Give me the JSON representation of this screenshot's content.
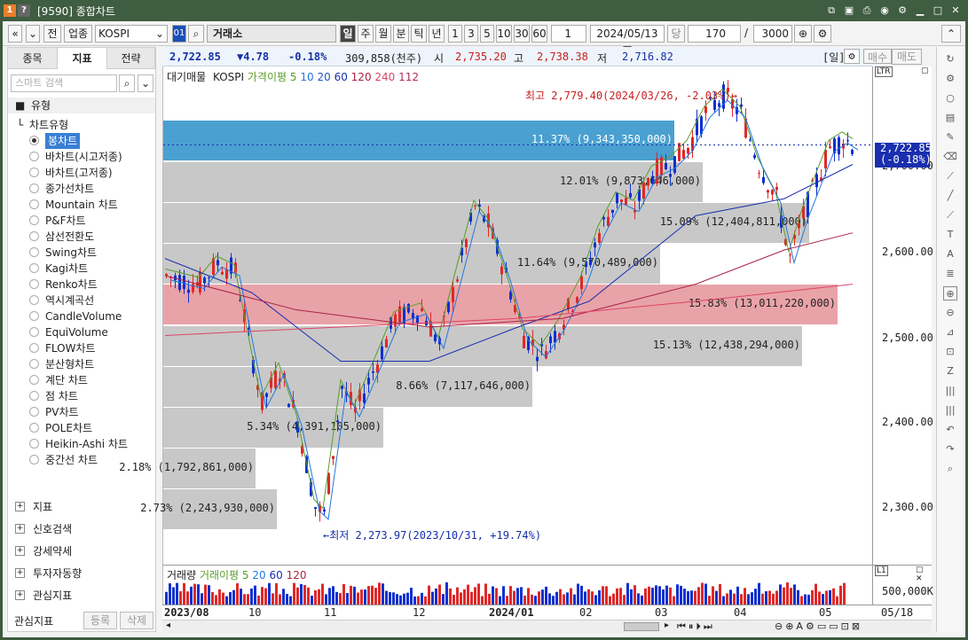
{
  "window": {
    "title": "[9590] 종합차트",
    "badge1": "1",
    "badge2": "?"
  },
  "toolbar": {
    "nav_prev": "«",
    "nav_down": "⌄",
    "jeon": "전",
    "category": "업종",
    "symbol": "KOSPI",
    "market_box": "01",
    "market_name": "거래소",
    "periods": [
      "일",
      "주",
      "월",
      "분",
      "틱",
      "년"
    ],
    "nums": [
      "1",
      "3",
      "5",
      "10",
      "30",
      "60"
    ],
    "period_count": "1",
    "date": "2024/05/13",
    "dang": "당",
    "count": "170",
    "slash": "/",
    "max": "3000"
  },
  "info": {
    "price": "2,722.85",
    "change": "▼4.78",
    "pct": "-0.18%",
    "volume": "309,858(천주)",
    "open_lbl": "시",
    "open": "2,735.20",
    "high_lbl": "고",
    "high": "2,738.38",
    "low_lbl": "저",
    "low": "2,716.82",
    "period": "[일]",
    "buy": "매수",
    "sell": "매도"
  },
  "left": {
    "tabs": [
      "종목",
      "지표",
      "전략"
    ],
    "search_placeholder": "스마트 검색",
    "type_header": "유형",
    "chart_type": "차트유형",
    "items": [
      "봉차트",
      "바차트(시고저종)",
      "바차트(고저종)",
      "종가선차트",
      "Mountain 차트",
      "P&F차트",
      "삼선전환도",
      "Swing차트",
      "Kagi차트",
      "Renko차트",
      "역시계곡선",
      "CandleVolume",
      "EquiVolume",
      "FLOW차트",
      "분산형차트",
      "계단 차트",
      "점 차트",
      "PV차트",
      "POLE차트",
      "Heikin-Ashi 차트",
      "중간선 차트"
    ],
    "sections": [
      "지표",
      "신호검색",
      "강세약세",
      "투자자동향",
      "관심지표"
    ],
    "bottom_label": "관심지표",
    "btn_reg": "등록",
    "btn_del": "삭제"
  },
  "legend": {
    "main": "대기매물",
    "sym": "KOSPI",
    "ma": "가격이평 5",
    "ma10": "10",
    "ma20": "20",
    "ma60": "60",
    "ma120": "120",
    "ma240": "240",
    "ma112": "112"
  },
  "vol_legend": {
    "main": "거래량",
    "ma": "거래이평 5",
    "ma20": "20",
    "ma60": "60",
    "ma120": "120"
  },
  "annotations": {
    "high": "최고 2,779.40(2024/03/26, -2.03%)→",
    "low": "←최저 2,273.97(2023/10/31, +19.74%)"
  },
  "current_price": {
    "price": "2,722.85",
    "pct": "(-0.18%)"
  },
  "y_ticks": [
    "2,700.00",
    "2,600.00",
    "2,500.00",
    "2,400.00",
    "2,300.00"
  ],
  "vol_tick": "500,000K",
  "x_labels": [
    "2023/08",
    "10",
    "11",
    "12",
    "2024/01",
    "02",
    "03",
    "04",
    "05"
  ],
  "x_last": "05/18",
  "volume_profile": [
    {
      "pct": "11.37%",
      "vol": "9,343,350,000",
      "ratio": 0.72,
      "kind": "blue"
    },
    {
      "pct": "12.01%",
      "vol": "9,873,646,000",
      "ratio": 0.76,
      "kind": "gray"
    },
    {
      "pct": "15.09%",
      "vol": "12,404,811,000",
      "ratio": 0.91,
      "kind": "gray"
    },
    {
      "pct": "11.64%",
      "vol": "9,570,489,000",
      "ratio": 0.7,
      "kind": "gray"
    },
    {
      "pct": "15.83%",
      "vol": "13,011,220,000",
      "ratio": 0.95,
      "kind": "pink"
    },
    {
      "pct": "15.13%",
      "vol": "12,438,294,000",
      "ratio": 0.9,
      "kind": "gray"
    },
    {
      "pct": "8.66%",
      "vol": "7,117,646,000",
      "ratio": 0.52,
      "kind": "gray"
    },
    {
      "pct": "5.34%",
      "vol": "4,391,105,000",
      "ratio": 0.31,
      "kind": "gray"
    },
    {
      "pct": "2.18%",
      "vol": "1,792,861,000",
      "ratio": 0.13,
      "kind": "gray"
    },
    {
      "pct": "2.73%",
      "vol": "2,243,930,000",
      "ratio": 0.16,
      "kind": "gray"
    }
  ],
  "colors": {
    "up": "#e02828",
    "down": "#1030d0",
    "ma5": "#5a9e2a",
    "ma10": "#2277dd",
    "ma20": "#2255bb",
    "ma60": "#1a2fae",
    "ma120": "#aa2244",
    "ma240": "#dd4466"
  }
}
